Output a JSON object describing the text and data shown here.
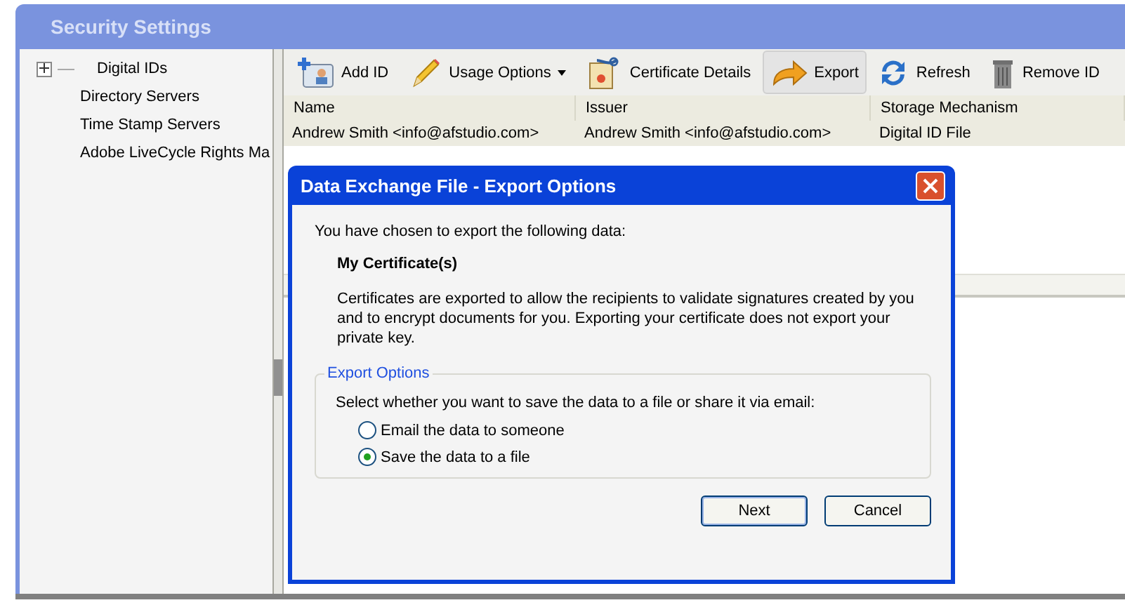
{
  "window": {
    "title": "Security Settings"
  },
  "sidebar": {
    "items": [
      {
        "label": "Digital IDs",
        "expandable": true
      },
      {
        "label": "Directory Servers",
        "expandable": false
      },
      {
        "label": "Time Stamp Servers",
        "expandable": false
      },
      {
        "label": "Adobe LiveCycle Rights Ma",
        "expandable": false
      }
    ]
  },
  "toolbar": [
    {
      "label": "Add ID",
      "kind": "add",
      "dropdown": false,
      "selected": false
    },
    {
      "label": "Usage Options",
      "kind": "usage",
      "dropdown": true,
      "selected": false
    },
    {
      "label": "Certificate Details",
      "kind": "details",
      "dropdown": false,
      "selected": false
    },
    {
      "label": "Export",
      "kind": "export",
      "dropdown": false,
      "selected": true
    },
    {
      "label": "Refresh",
      "kind": "refresh",
      "dropdown": false,
      "selected": false
    },
    {
      "label": "Remove ID",
      "kind": "remove",
      "dropdown": false,
      "selected": false
    }
  ],
  "table": {
    "columns": [
      "Name",
      "Issuer",
      "Storage Mechanism"
    ],
    "rows": [
      {
        "cells": [
          "Andrew Smith <info@afstudio.com>",
          "Andrew Smith <info@afstudio.com>",
          "Digital ID File"
        ],
        "selected": true
      }
    ]
  },
  "dialog": {
    "title": "Data Exchange File - Export Options",
    "intro": "You have chosen to export the following data:",
    "item": "My Certificate(s)",
    "description": "Certificates are exported to allow the recipients to validate signatures created by you and to encrypt documents for you. Exporting your certificate does not export your private key.",
    "group_title": "Export Options",
    "prompt": "Select whether you want to save the data to a file or share it via email:",
    "options": [
      {
        "label": "Email the data to someone",
        "selected": false
      },
      {
        "label": "Save the data to a file",
        "selected": true
      }
    ],
    "buttons": [
      {
        "label": "Next",
        "default": true
      },
      {
        "label": "Cancel",
        "default": false
      }
    ]
  }
}
